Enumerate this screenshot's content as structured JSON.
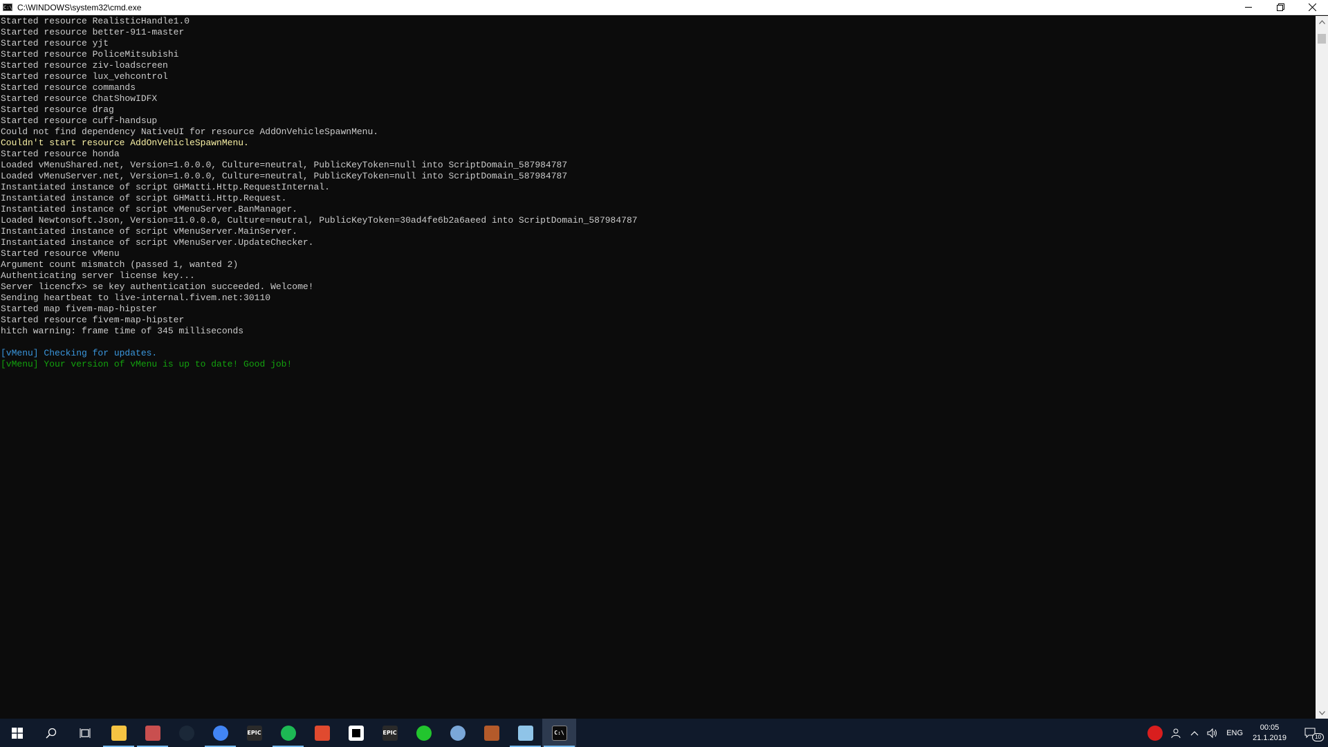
{
  "window": {
    "title": "C:\\WINDOWS\\system32\\cmd.exe",
    "app_icon": "C:\\"
  },
  "console": {
    "lines": [
      {
        "text": "Started resource RealisticHandle1.0",
        "color": "default"
      },
      {
        "text": "Started resource better-911-master",
        "color": "default"
      },
      {
        "text": "Started resource yjt",
        "color": "default"
      },
      {
        "text": "Started resource PoliceMitsubishi",
        "color": "default"
      },
      {
        "text": "Started resource ziv-loadscreen",
        "color": "default"
      },
      {
        "text": "Started resource lux_vehcontrol",
        "color": "default"
      },
      {
        "text": "Started resource commands",
        "color": "default"
      },
      {
        "text": "Started resource ChatShowIDFX",
        "color": "default"
      },
      {
        "text": "Started resource drag",
        "color": "default"
      },
      {
        "text": "Started resource cuff-handsup",
        "color": "default"
      },
      {
        "text": "Could not find dependency NativeUI for resource AddOnVehicleSpawnMenu.",
        "color": "default"
      },
      {
        "text": "Couldn't start resource AddOnVehicleSpawnMenu.",
        "color": "yellow"
      },
      {
        "text": "Started resource honda",
        "color": "default"
      },
      {
        "text": "Loaded vMenuShared.net, Version=1.0.0.0, Culture=neutral, PublicKeyToken=null into ScriptDomain_587984787",
        "color": "default"
      },
      {
        "text": "Loaded vMenuServer.net, Version=1.0.0.0, Culture=neutral, PublicKeyToken=null into ScriptDomain_587984787",
        "color": "default"
      },
      {
        "text": "Instantiated instance of script GHMatti.Http.RequestInternal.",
        "color": "default"
      },
      {
        "text": "Instantiated instance of script GHMatti.Http.Request.",
        "color": "default"
      },
      {
        "text": "Instantiated instance of script vMenuServer.BanManager.",
        "color": "default"
      },
      {
        "text": "Loaded Newtonsoft.Json, Version=11.0.0.0, Culture=neutral, PublicKeyToken=30ad4fe6b2a6aeed into ScriptDomain_587984787",
        "color": "default"
      },
      {
        "text": "Instantiated instance of script vMenuServer.MainServer.",
        "color": "default"
      },
      {
        "text": "Instantiated instance of script vMenuServer.UpdateChecker.",
        "color": "default"
      },
      {
        "text": "Started resource vMenu",
        "color": "default"
      },
      {
        "text": "Argument count mismatch (passed 1, wanted 2)",
        "color": "default"
      },
      {
        "text": "Authenticating server license key...",
        "color": "default"
      },
      {
        "text": "Server licencfx> se key authentication succeeded. Welcome!",
        "color": "default"
      },
      {
        "text": "Sending heartbeat to live-internal.fivem.net:30110",
        "color": "default"
      },
      {
        "text": "Started map fivem-map-hipster",
        "color": "default"
      },
      {
        "text": "Started resource fivem-map-hipster",
        "color": "default"
      },
      {
        "text": "hitch warning: frame time of 345 milliseconds",
        "color": "default"
      },
      {
        "text": "",
        "color": "default"
      },
      {
        "text": "[vMenu] Checking for updates.",
        "color": "blue"
      },
      {
        "text": "[vMenu] Your version of vMenu is up to date! Good job!",
        "color": "green"
      }
    ]
  },
  "taskbar": {
    "apps": [
      {
        "name": "file-explorer",
        "label": "",
        "color": "#f5c342",
        "active": true,
        "current": false
      },
      {
        "name": "mail-app",
        "label": "",
        "color": "#c94f4f",
        "active": true,
        "current": false
      },
      {
        "name": "steam",
        "label": "",
        "color": "#1b2838",
        "active": false,
        "current": false
      },
      {
        "name": "chrome",
        "label": "",
        "color": "#4285f4",
        "active": true,
        "current": false
      },
      {
        "name": "epic-games",
        "label": "EPIC",
        "color": "#2a2a2a",
        "active": false,
        "current": false
      },
      {
        "name": "spotify",
        "label": "",
        "color": "#1db954",
        "active": true,
        "current": false
      },
      {
        "name": "red-app",
        "label": "",
        "color": "#e04a2f",
        "active": false,
        "current": false
      },
      {
        "name": "black-square-app",
        "label": "",
        "color": "#ffffff",
        "active": false,
        "current": false
      },
      {
        "name": "epic-games-2",
        "label": "EPIC",
        "color": "#2a2a2a",
        "active": false,
        "current": false
      },
      {
        "name": "green-cloud-app",
        "label": "",
        "color": "#22c52e",
        "active": false,
        "current": false
      },
      {
        "name": "sync-app",
        "label": "",
        "color": "#7aa7d8",
        "active": false,
        "current": false
      },
      {
        "name": "game-app",
        "label": "",
        "color": "#b45a2a",
        "active": false,
        "current": false
      },
      {
        "name": "notepad",
        "label": "",
        "color": "#8fc4e8",
        "active": true,
        "current": false
      },
      {
        "name": "cmd",
        "label": "C:\\",
        "color": "#0c0c0c",
        "active": true,
        "current": true
      }
    ],
    "tray": {
      "language": "ENG",
      "time": "00:05",
      "date": "21.1.2019",
      "notification_count": "10"
    }
  }
}
